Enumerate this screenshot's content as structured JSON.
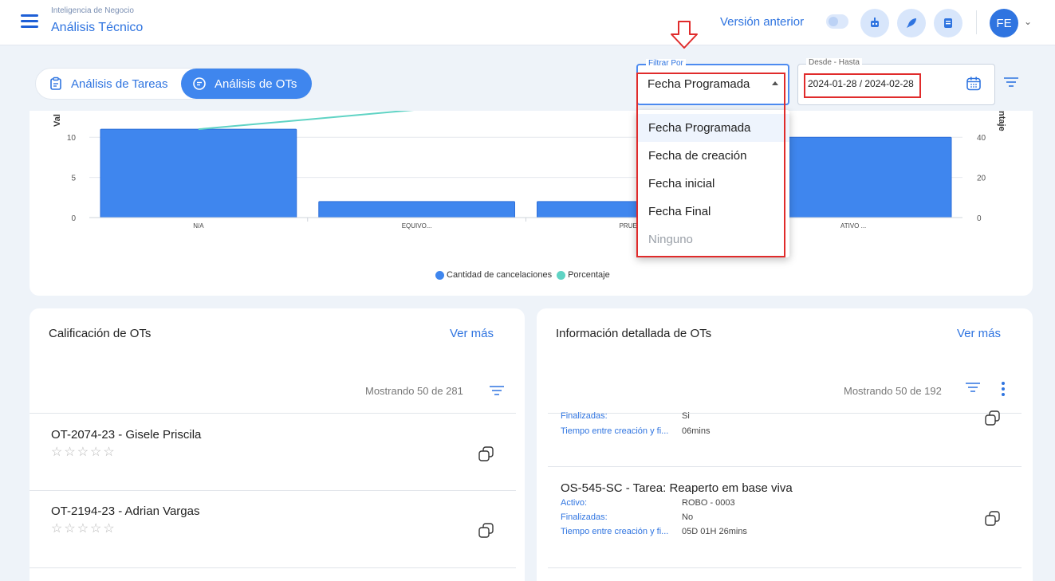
{
  "header": {
    "breadcrumb_sub": "Inteligencia de Negocio",
    "breadcrumb_main": "Análisis Técnico",
    "prev_version_label": "Versión anterior",
    "avatar_initials": "FE",
    "icons": [
      "menu-icon",
      "robot-icon",
      "rocket-icon",
      "document-icon",
      "chevron-down-icon"
    ]
  },
  "tabs": [
    {
      "label": "Análisis de Tareas",
      "active": false
    },
    {
      "label": "Análisis de OTs",
      "active": true
    }
  ],
  "filter": {
    "legend": "Filtrar Por",
    "value": "Fecha Programada",
    "options": [
      "Fecha Programada",
      "Fecha de creación",
      "Fecha inicial",
      "Fecha Final",
      "Ninguno"
    ],
    "disabled_option": "Ninguno"
  },
  "date_range": {
    "legend": "Desde - Hasta",
    "value": "2024-01-28 / 2024-02-28"
  },
  "chart_data": {
    "type": "bar",
    "categories": [
      "N/A",
      "EQUIVO...",
      "PRUEBA...",
      "ATIVO ..."
    ],
    "series": [
      {
        "name": "Cantidad de cancelaciones",
        "values": [
          11,
          2,
          2,
          10
        ],
        "color": "#3f86ee"
      },
      {
        "name": "Porcentaje",
        "values": [
          44,
          null,
          null,
          null
        ],
        "color": "#5fd3c4"
      }
    ],
    "ylabel": "Val",
    "y2label": "ntaje",
    "y_ticks": [
      "0",
      "5",
      "10"
    ],
    "y2_ticks": [
      "0",
      "20",
      "40"
    ],
    "ylim": [
      0,
      12.5
    ],
    "y2lim": [
      0,
      50
    ]
  },
  "calificacion": {
    "title": "Calificación de OTs",
    "see_more": "Ver más",
    "showing": "Mostrando 50 de 281",
    "rows": [
      {
        "title": "OT-2074-23 - Gisele Priscila",
        "stars": "☆☆☆☆☆"
      },
      {
        "title": "OT-2194-23 - Adrian Vargas",
        "stars": "☆☆☆☆☆"
      }
    ]
  },
  "info": {
    "title": "Información detallada de OTs",
    "see_more": "Ver más",
    "showing": "Mostrando 50 de 192",
    "partial_row": [
      {
        "key": "Finalizadas:",
        "value": "Si"
      },
      {
        "key": "Tiempo entre creación y fi...",
        "value": "06mins"
      }
    ],
    "row": {
      "title": "OS-545-SC - Tarea: Reaperto em base viva",
      "fields": [
        {
          "key": "Activo:",
          "value": "ROBO - 0003"
        },
        {
          "key": "Finalizadas:",
          "value": "No"
        },
        {
          "key": "Tiempo entre creación y fi...",
          "value": "05D 01H 26mins"
        }
      ]
    }
  }
}
